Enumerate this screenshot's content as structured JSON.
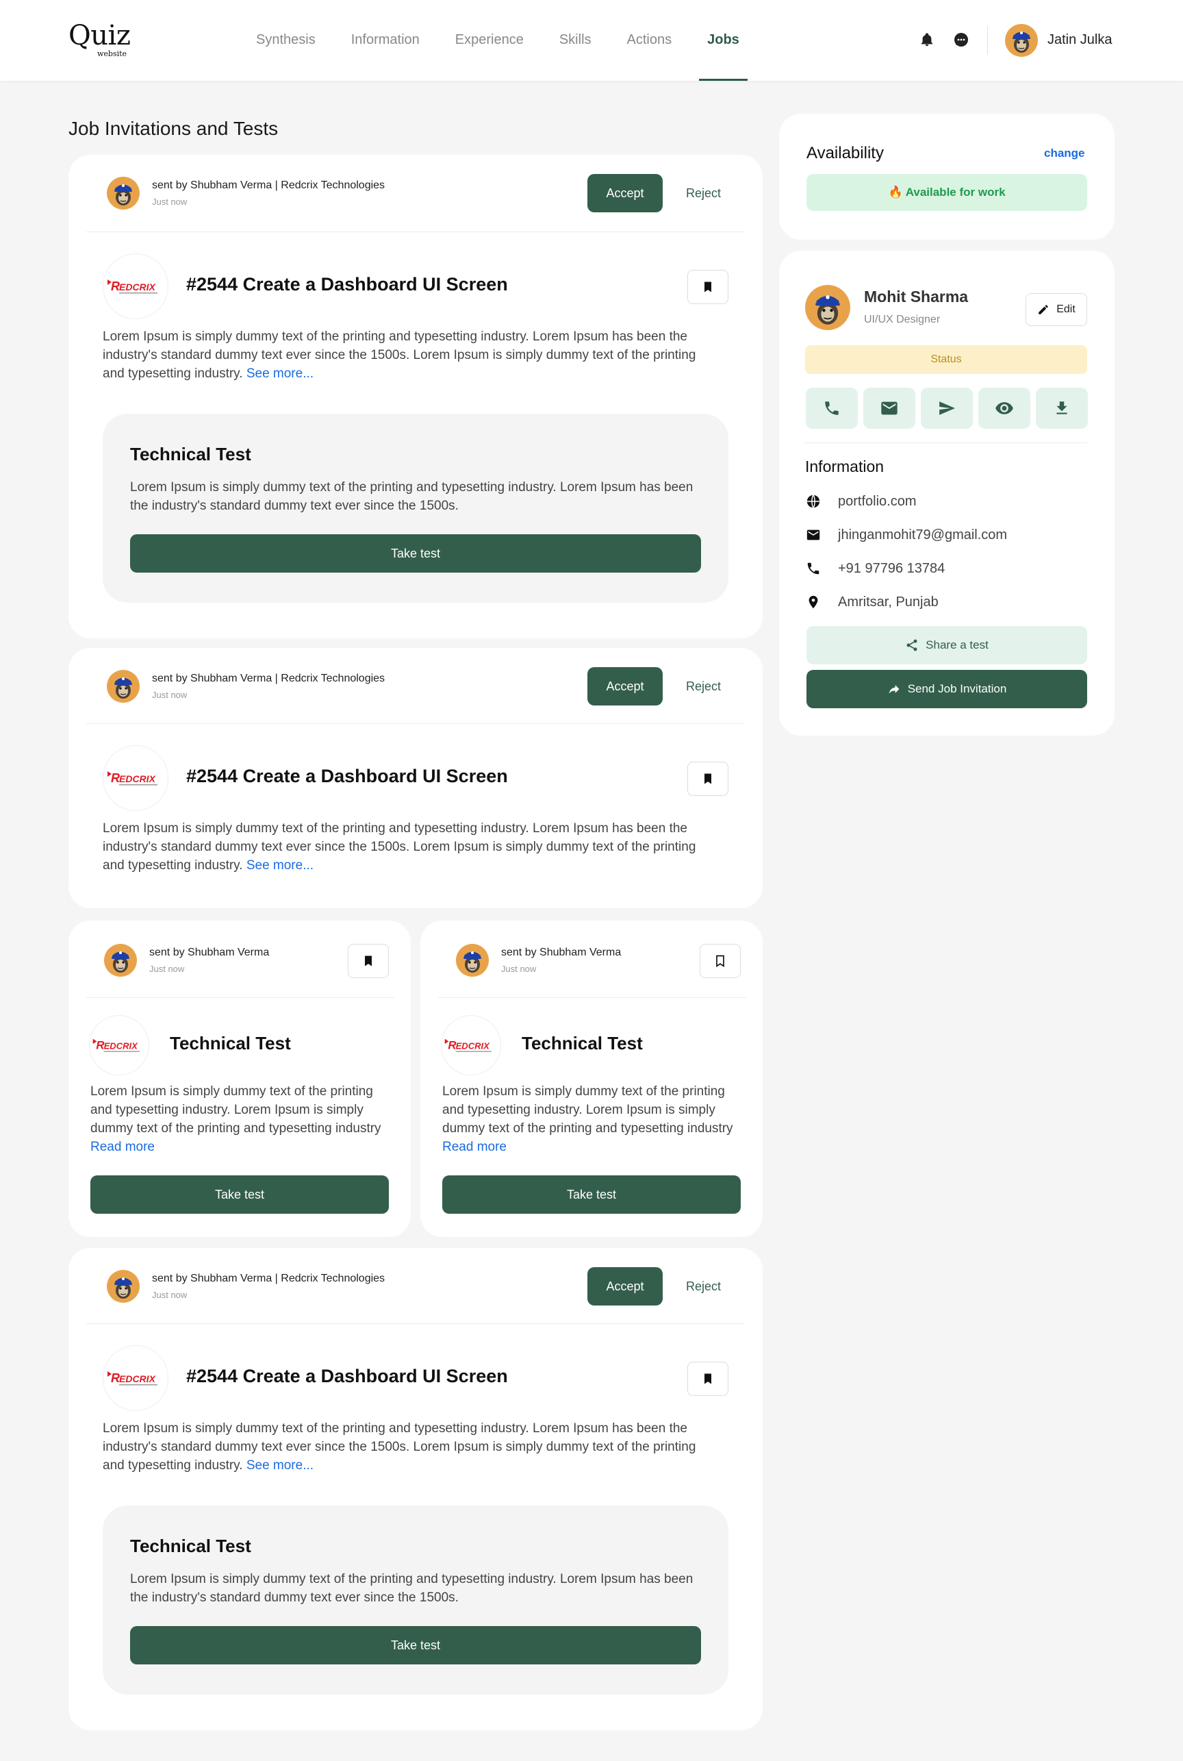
{
  "header": {
    "logo_main": "Quiz",
    "logo_sub": "website",
    "nav": [
      {
        "label": "Synthesis"
      },
      {
        "label": "Information"
      },
      {
        "label": "Experience"
      },
      {
        "label": "Skills"
      },
      {
        "label": "Actions"
      },
      {
        "label": "Jobs",
        "active": true
      }
    ],
    "user_name": "Jatin Julka"
  },
  "page_title": "Job Invitations and Tests",
  "cards": [
    {
      "sender": "sent by Shubham Verma | Redcrix Technologies",
      "time": "Just now",
      "accept": "Accept",
      "reject": "Reject",
      "title": "#2544 Create a Dashboard UI Screen",
      "desc": "Lorem Ipsum is simply dummy text of the printing and typesetting industry. Lorem Ipsum has been the industry's standard dummy text ever since the 1500s. Lorem Ipsum is simply dummy text of the printing and typesetting industry.",
      "see_more": "See more...",
      "test": {
        "title": "Technical Test",
        "desc": "Lorem Ipsum is simply dummy text of the printing and typesetting industry. Lorem Ipsum has been the industry's standard dummy text ever since the 1500s.",
        "button": "Take test"
      }
    },
    {
      "sender": "sent by Shubham Verma | Redcrix Technologies",
      "time": "Just now",
      "accept": "Accept",
      "reject": "Reject",
      "title": "#2544 Create a Dashboard UI Screen",
      "desc": "Lorem Ipsum is simply dummy text of the printing and typesetting industry. Lorem Ipsum has been the industry's standard dummy text ever since the 1500s. Lorem Ipsum is simply dummy text of the printing and typesetting industry.",
      "see_more": "See more..."
    },
    {
      "sender": "sent by Shubham Verma | Redcrix Technologies",
      "time": "Just now",
      "accept": "Accept",
      "reject": "Reject",
      "title": "#2544 Create a Dashboard UI Screen",
      "desc": "Lorem Ipsum is simply dummy text of the printing and typesetting industry. Lorem Ipsum has been the industry's standard dummy text ever since the 1500s. Lorem Ipsum is simply dummy text of the printing and typesetting industry.",
      "see_more": "See more...",
      "test": {
        "title": "Technical Test",
        "desc": "Lorem Ipsum is simply dummy text of the printing and typesetting industry. Lorem Ipsum has been the industry's standard dummy text ever since the 1500s.",
        "button": "Take test"
      }
    }
  ],
  "small_cards": [
    {
      "sender": "sent by Shubham Verma",
      "time": "Just now",
      "title": "Technical Test",
      "desc": "Lorem Ipsum is simply dummy text of the printing and typesetting industry. Lorem Ipsum is simply dummy text of the printing and typesetting industry",
      "read_more": "Read more",
      "button": "Take test",
      "bookmarked": true
    },
    {
      "sender": "sent by Shubham Verma",
      "time": "Just now",
      "title": "Technical Test",
      "desc": "Lorem Ipsum is simply dummy text of the printing and typesetting industry. Lorem Ipsum is simply dummy text of the printing and typesetting industry",
      "read_more": "Read more",
      "button": "Take test",
      "bookmarked": false
    }
  ],
  "availability": {
    "title": "Availability",
    "change": "change",
    "badge": "🔥 Available for work"
  },
  "profile": {
    "name": "Mohit Sharma",
    "role": "UI/UX Designer",
    "edit": "Edit",
    "status": "Status",
    "actions": [
      "phone-icon",
      "mail-icon",
      "send-icon",
      "eye-icon",
      "download-icon"
    ],
    "info_title": "Information",
    "info": [
      {
        "icon": "globe-icon",
        "text": "portfolio.com"
      },
      {
        "icon": "mail-icon",
        "text": "jhinganmohit79@gmail.com"
      },
      {
        "icon": "phone-icon",
        "text": "+91 97796 13784"
      },
      {
        "icon": "location-icon",
        "text": "Amritsar, Punjab"
      }
    ],
    "share": "Share a test",
    "invite": "Send Job Invitation"
  },
  "colors": {
    "primary": "#335e4c",
    "accent_link": "#1a6be0",
    "available_bg": "#d9f5e2",
    "status_bg": "#fdf0c8"
  }
}
